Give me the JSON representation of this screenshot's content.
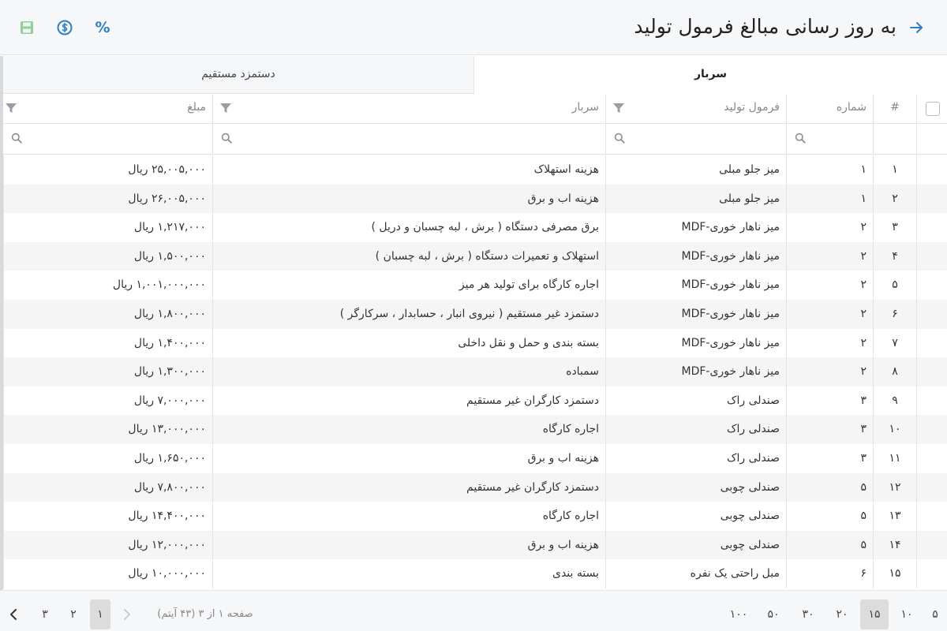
{
  "header": {
    "title": "به روز رسانی مبالغ فرمول تولید",
    "percent_label": "%"
  },
  "tabs": [
    {
      "label": "سربار",
      "active": true
    },
    {
      "label": "دستمزد مستقیم",
      "active": false
    }
  ],
  "columns": {
    "index": "#",
    "number": "شماره",
    "formula": "فرمول تولید",
    "overhead": "سربار",
    "amount": "مبلغ"
  },
  "rows": [
    {
      "idx": "۱",
      "num": "۱",
      "formula": "میز جلو مبلی",
      "overhead": "هزینه استهلاک",
      "amount": "۲۵,۰۰۵,۰۰۰ ریال"
    },
    {
      "idx": "۲",
      "num": "۱",
      "formula": "میز جلو مبلی",
      "overhead": "هزینه اب و برق",
      "amount": "۲۶,۰۰۵,۰۰۰ ریال"
    },
    {
      "idx": "۳",
      "num": "۲",
      "formula": "میز ناهار خوری-MDF",
      "overhead": "برق مصرفی دستگاه ( برش ، لبه چسبان و دریل )",
      "amount": "۱,۲۱۷,۰۰۰ ریال"
    },
    {
      "idx": "۴",
      "num": "۲",
      "formula": "میز ناهار خوری-MDF",
      "overhead": "استهلاک و تعمیرات دستگاه ( برش ، لبه چسبان )",
      "amount": "۱,۵۰۰,۰۰۰ ریال"
    },
    {
      "idx": "۵",
      "num": "۲",
      "formula": "میز ناهار خوری-MDF",
      "overhead": "اجاره کارگاه برای تولید هر میز",
      "amount": "۱,۰۰۱,۰۰۰,۰۰۰ ریال"
    },
    {
      "idx": "۶",
      "num": "۲",
      "formula": "میز ناهار خوری-MDF",
      "overhead": "دستمزد غیر مستقیم ( نیروی انبار ، حسابدار ، سرکارگر )",
      "amount": "۱,۸۰۰,۰۰۰ ریال"
    },
    {
      "idx": "۷",
      "num": "۲",
      "formula": "میز ناهار خوری-MDF",
      "overhead": "بسته بندی و حمل و نقل داخلی",
      "amount": "۱,۴۰۰,۰۰۰ ریال"
    },
    {
      "idx": "۸",
      "num": "۲",
      "formula": "میز ناهار خوری-MDF",
      "overhead": "سمباده",
      "amount": "۱,۳۰۰,۰۰۰ ریال"
    },
    {
      "idx": "۹",
      "num": "۳",
      "formula": "صندلی راک",
      "overhead": "دستمزد کارگران غیر مستقیم",
      "amount": "۷,۰۰۰,۰۰۰ ریال"
    },
    {
      "idx": "۱۰",
      "num": "۳",
      "formula": "صندلی راک",
      "overhead": "اجاره کارگاه",
      "amount": "۱۳,۰۰۰,۰۰۰ ریال"
    },
    {
      "idx": "۱۱",
      "num": "۳",
      "formula": "صندلی راک",
      "overhead": "هزینه اب و برق",
      "amount": "۱,۶۵۰,۰۰۰ ریال"
    },
    {
      "idx": "۱۲",
      "num": "۵",
      "formula": "صندلی چوبی",
      "overhead": "دستمزد کارگران غیر مستقیم",
      "amount": "۷,۸۰۰,۰۰۰ ریال"
    },
    {
      "idx": "۱۳",
      "num": "۵",
      "formula": "صندلی چوبی",
      "overhead": "اجاره کارگاه",
      "amount": "۱۴,۴۰۰,۰۰۰ ریال"
    },
    {
      "idx": "۱۴",
      "num": "۵",
      "formula": "صندلی چوبی",
      "overhead": "هزینه اب و برق",
      "amount": "۱۲,۰۰۰,۰۰۰ ریال"
    },
    {
      "idx": "۱۵",
      "num": "۶",
      "formula": "مبل راحتی یک نفره",
      "overhead": "بسته بندی",
      "amount": "۱۰,۰۰۰,۰۰۰ ریال"
    }
  ],
  "pager": {
    "page_sizes": [
      "۵",
      "۱۰",
      "۱۵",
      "۲۰",
      "۳۰",
      "۵۰",
      "۱۰۰"
    ],
    "active_size": "۱۵",
    "info": "صفحه ۱ از ۳ (۴۳ آیتم)",
    "pages": [
      "۱",
      "۲",
      "۳"
    ],
    "active_page": "۱"
  },
  "colors": {
    "accent": "#2f7ec4",
    "save_icon": "#8fcf9a",
    "header_bg": "#f6f7f9"
  }
}
